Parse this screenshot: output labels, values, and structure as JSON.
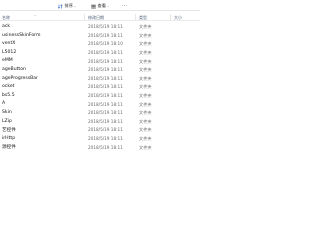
{
  "toolbar": {
    "sort_label": "排序",
    "view_label": "查看"
  },
  "columns": {
    "name": "名称",
    "date": "修改日期",
    "type": "类型",
    "size": "大小"
  },
  "rows": [
    {
      "name": "ack",
      "date": "2018/5/19 18:11",
      "type": "文件夹"
    },
    {
      "name": "usinessSkinForm",
      "date": "2018/5/19 18:11",
      "type": "文件夹"
    },
    {
      "name": "ventX",
      "date": "2018/5/19 18:10",
      "type": "文件夹"
    },
    {
      "name": "L5012",
      "date": "2018/5/19 18:11",
      "type": "文件夹"
    },
    {
      "name": "eMM",
      "date": "2018/5/19 18:11",
      "type": "文件夹"
    },
    {
      "name": "ageButton",
      "date": "2018/5/19 18:11",
      "type": "文件夹"
    },
    {
      "name": "ageProgressBar",
      "date": "2018/5/19 18:11",
      "type": "文件夹"
    },
    {
      "name": "ocket",
      "date": "2018/5/19 18:11",
      "type": "文件夹"
    },
    {
      "name": "bs5.5",
      "date": "2018/5/19 18:11",
      "type": "文件夹"
    },
    {
      "name": "A",
      "date": "2018/5/19 18:11",
      "type": "文件夹"
    },
    {
      "name": "Skin",
      "date": "2018/5/19 18:11",
      "type": "文件夹"
    },
    {
      "name": "LZip",
      "date": "2018/5/19 18:11",
      "type": "文件夹"
    },
    {
      "name": "艺控件",
      "date": "2018/5/19 18:11",
      "type": "文件夹"
    },
    {
      "name": "irHttp",
      "date": "2018/5/19 18:11",
      "type": "文件夹"
    },
    {
      "name": "源控件",
      "date": "2018/5/19 18:11",
      "type": "文件夹"
    }
  ]
}
